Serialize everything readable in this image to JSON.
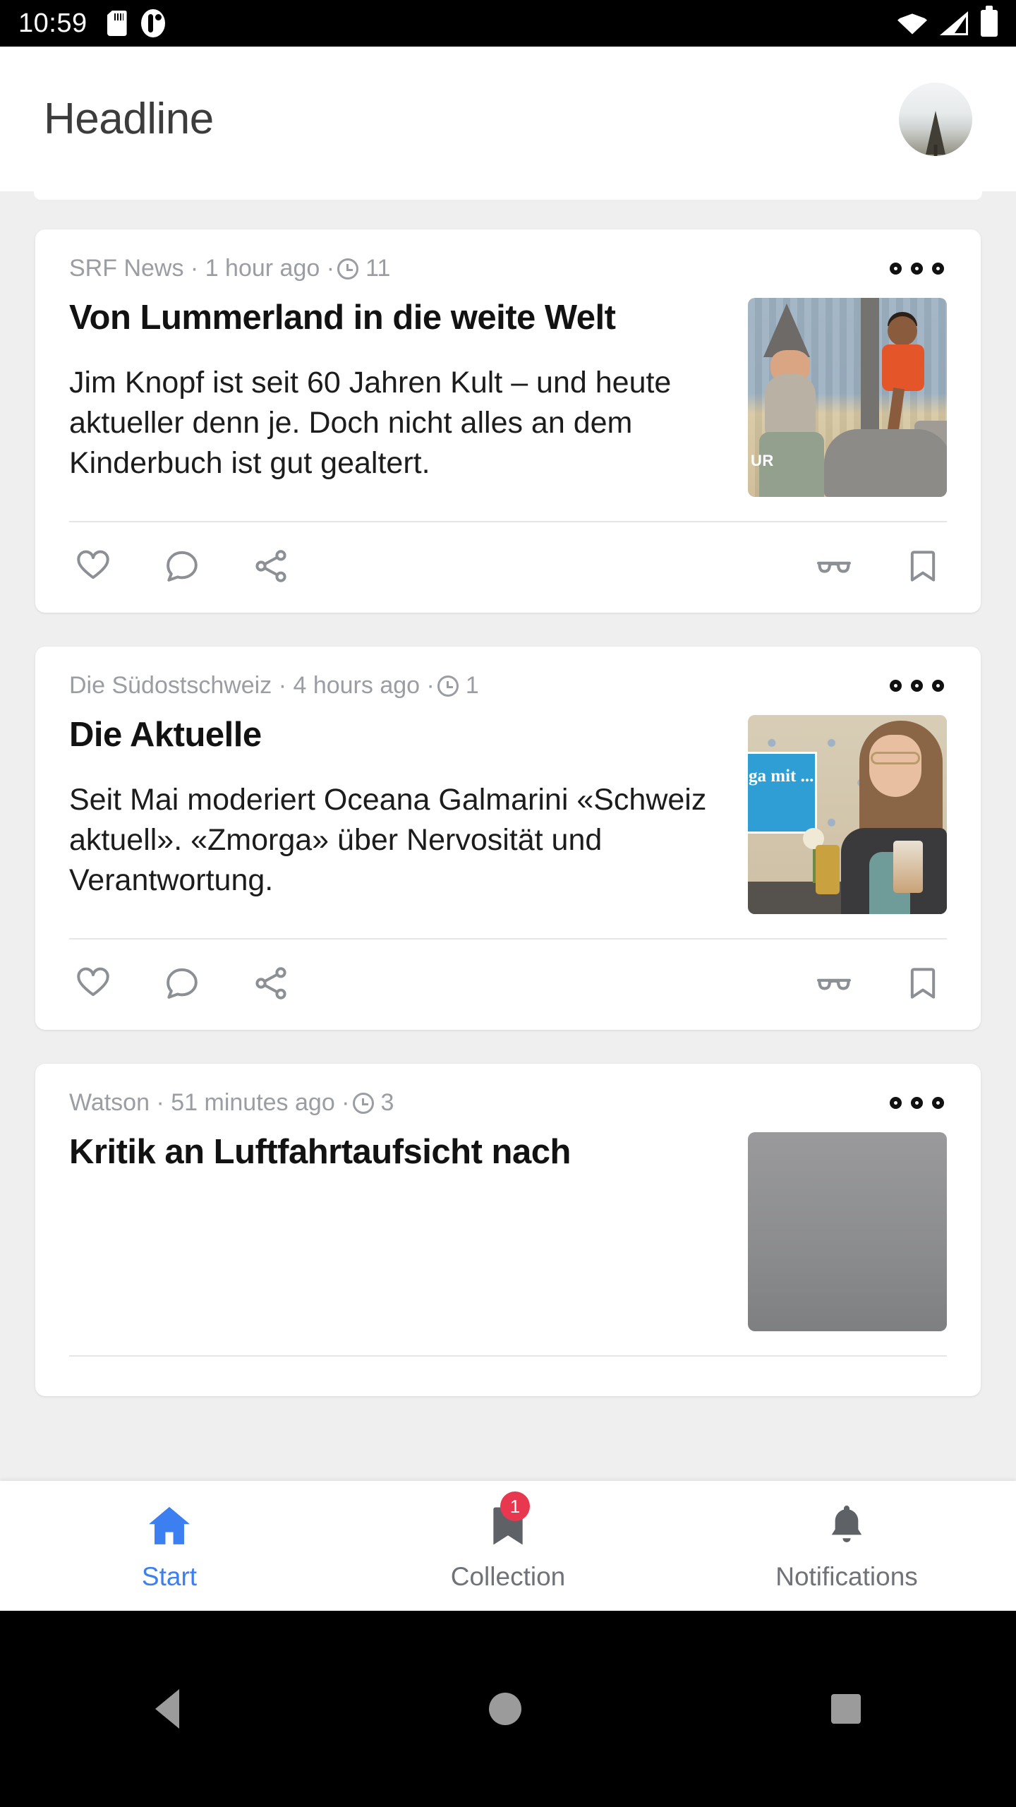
{
  "status_bar": {
    "time": "10:59",
    "left_icons": [
      "sd-card-icon",
      "app-circle-icon"
    ],
    "right_icons": [
      "wifi-icon",
      "cellular-signal-icon",
      "battery-icon"
    ]
  },
  "app_bar": {
    "title": "Headline",
    "avatar_alt": "profile-avatar"
  },
  "feed": {
    "cards": [
      {
        "source": "SRF News",
        "time_ago": "1 hour ago",
        "read_minutes": "11",
        "title": "Von Lummerland in die weite Welt",
        "description": "Jim Knopf ist seit 60 Jahren Kult – und heute aktueller denn je. Doch nicht alles an dem Kinderbuch ist gut gealtert.",
        "thumb_alt": "puppet-theatre-scene-thumbnail",
        "thumb_watermark": "UR"
      },
      {
        "source": "Die Südostschweiz",
        "time_ago": "4 hours ago",
        "read_minutes": "1",
        "title": "Die Aktuelle",
        "description": "Seit Mai moderiert Oceana Galmarini «Schweiz aktuell». «Zmorga» über Nervosität und Verantwortung.",
        "thumb_alt": "woman-at-cafe-thumbnail",
        "thumb_sign_text": "ga mit ..."
      },
      {
        "source": "Watson",
        "time_ago": "51 minutes ago",
        "read_minutes": "3",
        "title": "Kritik an Luftfahrtaufsicht nach",
        "description": "",
        "thumb_alt": "gray-photo-thumbnail"
      }
    ],
    "action_icons": [
      "heart-icon",
      "comment-icon",
      "share-icon",
      "glasses-icon",
      "bookmark-icon"
    ],
    "overflow_icon": "more-options-icon"
  },
  "bottom_nav": {
    "items": [
      {
        "label": "Start",
        "icon": "home-icon",
        "active": true,
        "badge": ""
      },
      {
        "label": "Collection",
        "icon": "bookmark-icon",
        "active": false,
        "badge": "1"
      },
      {
        "label": "Notifications",
        "icon": "bell-icon",
        "active": false,
        "badge": ""
      }
    ]
  },
  "android_nav": {
    "buttons": [
      "back-button",
      "home-button",
      "recent-apps-button"
    ]
  },
  "colors": {
    "accent_blue": "#3C7FF0",
    "badge_red": "#E8384F",
    "meta_gray": "#9A9DA2",
    "icon_gray": "#8C9095",
    "page_bg": "#EFEFEF"
  }
}
